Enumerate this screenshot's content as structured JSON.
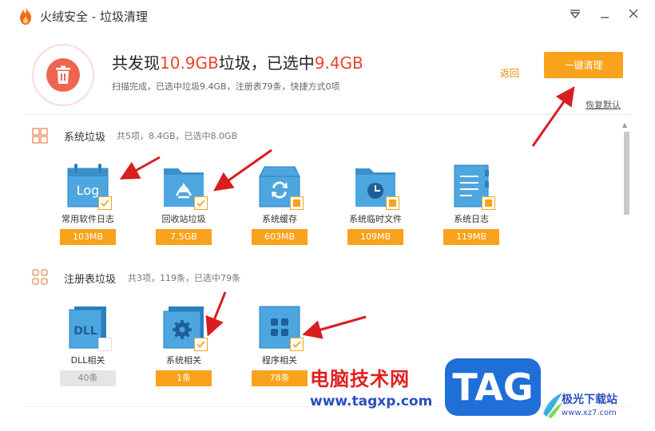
{
  "window": {
    "title": "火绒安全 - 垃圾清理",
    "controls": {
      "menu": "menu-icon",
      "minimize": "minimize-icon",
      "close": "close-icon"
    }
  },
  "header": {
    "headline_prefix": "共发现",
    "found_size": "10.9GB",
    "headline_mid": "垃圾，已选中",
    "selected_size": "9.4GB",
    "subline": "扫描完成，已选中垃圾9.4GB，注册表79条，快捷方式0项",
    "back_label": "返回",
    "clean_label": "一键清理",
    "restore_label": "恢复默认"
  },
  "sections": [
    {
      "title": "系统垃圾",
      "summary": "共5项，8.4GB，已选中8.0GB",
      "items": [
        {
          "label": "常用软件日志",
          "size": "103MB",
          "check": "checked",
          "icon": "log-file-icon",
          "icon_text": "Log"
        },
        {
          "label": "回收站垃圾",
          "size": "7.5GB",
          "check": "checked",
          "icon": "recycle-folder-icon"
        },
        {
          "label": "系统缓存",
          "size": "603MB",
          "check": "partial",
          "icon": "cache-drive-icon"
        },
        {
          "label": "系统临时文件",
          "size": "109MB",
          "check": "partial",
          "icon": "temp-folder-icon"
        },
        {
          "label": "系统日志",
          "size": "119MB",
          "check": "partial",
          "icon": "system-log-icon"
        }
      ]
    },
    {
      "title": "注册表垃圾",
      "summary": "共3项，119条，已选中79条",
      "items": [
        {
          "label": "DLL相关",
          "size": "40条",
          "check": "unchecked",
          "icon": "dll-file-icon",
          "icon_text": "DLL"
        },
        {
          "label": "系统相关",
          "size": "1条",
          "check": "checked",
          "icon": "system-gear-icon"
        },
        {
          "label": "程序相关",
          "size": "78条",
          "check": "checked",
          "icon": "program-apps-icon"
        }
      ]
    }
  ],
  "watermark": {
    "cn": "电脑技术网",
    "url": "www.tagxp.com",
    "tag": "TAG",
    "site": "极光下载站",
    "site_url": "www.xz7.com"
  },
  "colors": {
    "accent": "#f9a21b",
    "danger": "#e8462c",
    "icon_blue": "#4da6e0"
  }
}
